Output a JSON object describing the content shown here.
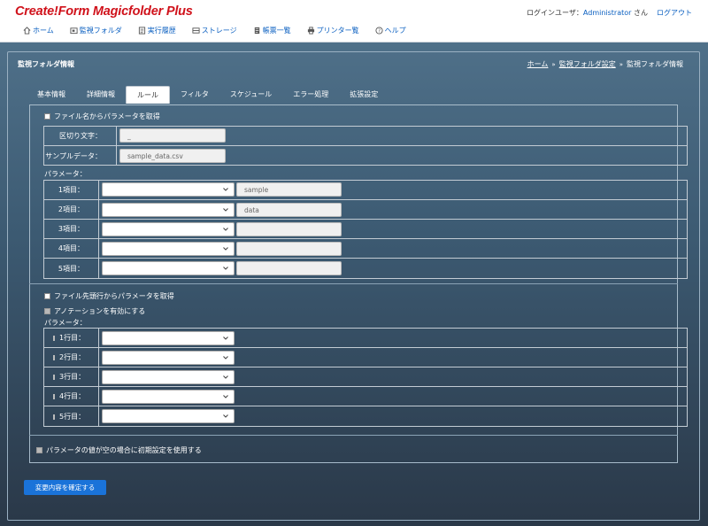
{
  "app": {
    "title": "Create!Form Magicfolder Plus"
  },
  "login": {
    "prefix": "ログインユーザ：",
    "user": "Administrator",
    "suffix": " さん",
    "logout": "ログアウト"
  },
  "nav": [
    {
      "label": "ホーム",
      "icon": "home-icon"
    },
    {
      "label": "監視フォルダ",
      "icon": "folder-monitor-icon"
    },
    {
      "label": "実行履歴",
      "icon": "history-icon"
    },
    {
      "label": "ストレージ",
      "icon": "storage-icon"
    },
    {
      "label": "帳票一覧",
      "icon": "document-list-icon"
    },
    {
      "label": "プリンター覧",
      "icon": "printer-icon"
    },
    {
      "label": "ヘルプ",
      "icon": "help-icon"
    }
  ],
  "panel": {
    "title": "監視フォルダ情報"
  },
  "breadcrumb": {
    "home": "ホーム",
    "settings": "監視フォルダ設定",
    "current": "監視フォルダ情報",
    "sep": "»"
  },
  "tabs": [
    {
      "label": "基本情報",
      "active": false
    },
    {
      "label": "詳細情報",
      "active": false
    },
    {
      "label": "ルール",
      "active": true
    },
    {
      "label": "フィルタ",
      "active": false
    },
    {
      "label": "スケジュール",
      "active": false
    },
    {
      "label": "エラー処理",
      "active": false
    },
    {
      "label": "拡張設定",
      "active": false
    }
  ],
  "filename_section": {
    "checkbox_label": "ファイル名からパラメータを取得",
    "delimiter_label": "区切り文字：",
    "delimiter_value": "_",
    "sample_label": "サンプルデータ：",
    "sample_value": "sample_data.csv",
    "params_label": "パラメータ：",
    "items": [
      {
        "label": "1項目：",
        "value": "sample"
      },
      {
        "label": "2項目：",
        "value": "data"
      },
      {
        "label": "3項目：",
        "value": ""
      },
      {
        "label": "4項目：",
        "value": ""
      },
      {
        "label": "5項目：",
        "value": ""
      }
    ]
  },
  "fileline_section": {
    "checkbox_label": "ファイル先頭行からパラメータを取得",
    "annotation_label": "アノテーションを有効にする",
    "params_label": "パラメータ：",
    "rows": [
      {
        "label": "1行目："
      },
      {
        "label": "2行目："
      },
      {
        "label": "3行目："
      },
      {
        "label": "4行目："
      },
      {
        "label": "5行目："
      }
    ]
  },
  "default_option": {
    "label": "パラメータの値が空の場合に初期設定を使用する"
  },
  "submit": {
    "label": "変更内容を確定する"
  },
  "colors": {
    "brand": "#d0121b",
    "link": "#0a5fc0",
    "button": "#1a73d9"
  }
}
